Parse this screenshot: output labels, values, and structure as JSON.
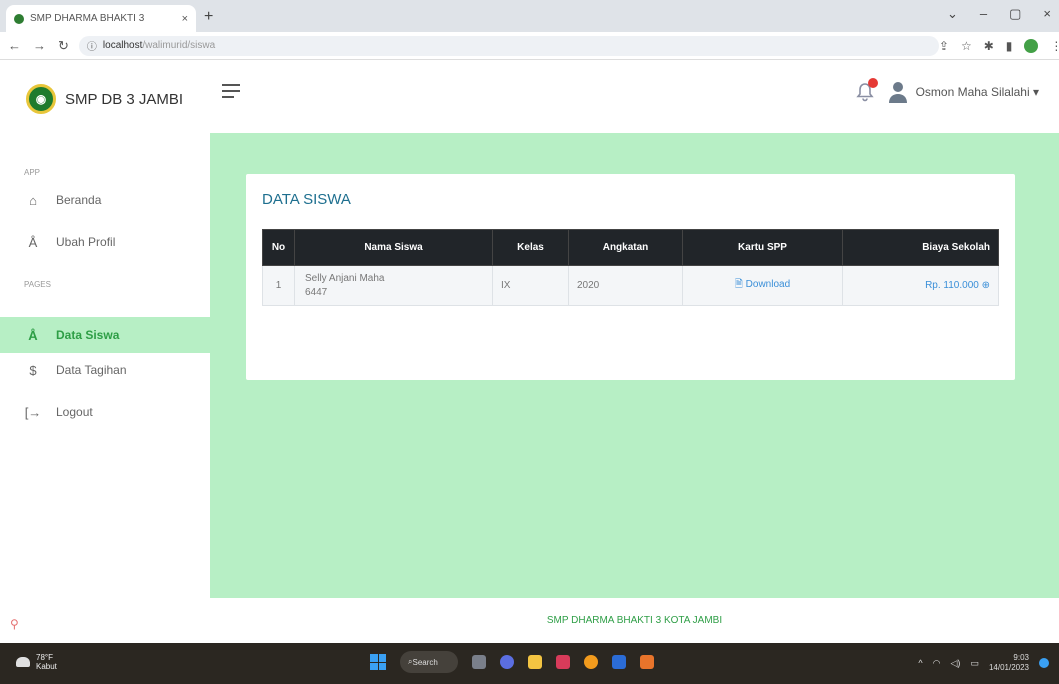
{
  "browser": {
    "tab_title": "SMP DHARMA BHAKTI 3",
    "tab_close": "×",
    "new_tab": "+",
    "url_host": "localhost",
    "url_path": "/walimurid/siswa",
    "window_controls": [
      "⌄",
      "–",
      "▢",
      "×"
    ]
  },
  "app": {
    "brand": "SMP DB 3 JAMBI",
    "user_name": "Osmon Maha Silalahi ▾",
    "sidebar": {
      "section_app": "APP",
      "section_pages": "PAGES",
      "items": [
        {
          "label": "Beranda",
          "icon": "home-icon"
        },
        {
          "label": "Ubah Profil",
          "icon": "user-icon"
        },
        {
          "label": "Data Siswa",
          "icon": "user-icon",
          "active": true
        },
        {
          "label": "Data Tagihan",
          "icon": "dollar-icon"
        },
        {
          "label": "Logout",
          "icon": "logout-icon"
        }
      ]
    },
    "card": {
      "title": "DATA SISWA",
      "columns": [
        "No",
        "Nama Siswa",
        "Kelas",
        "Angkatan",
        "Kartu SPP",
        "Biaya Sekolah"
      ],
      "rows": [
        {
          "no": "1",
          "nama": "Selly Anjani Maha",
          "nis": "6447",
          "kelas": "IX",
          "angkatan": "2020",
          "kartu": "Download",
          "biaya": "Rp. 110.000"
        }
      ]
    },
    "footer": "SMP DHARMA BHAKTI 3 KOTA JAMBI",
    "accent": "#b7efc5"
  },
  "taskbar": {
    "weather_temp": "78°F",
    "weather_desc": "Kabut",
    "search": "Search",
    "time": "9:03",
    "date": "14/01/2023"
  }
}
